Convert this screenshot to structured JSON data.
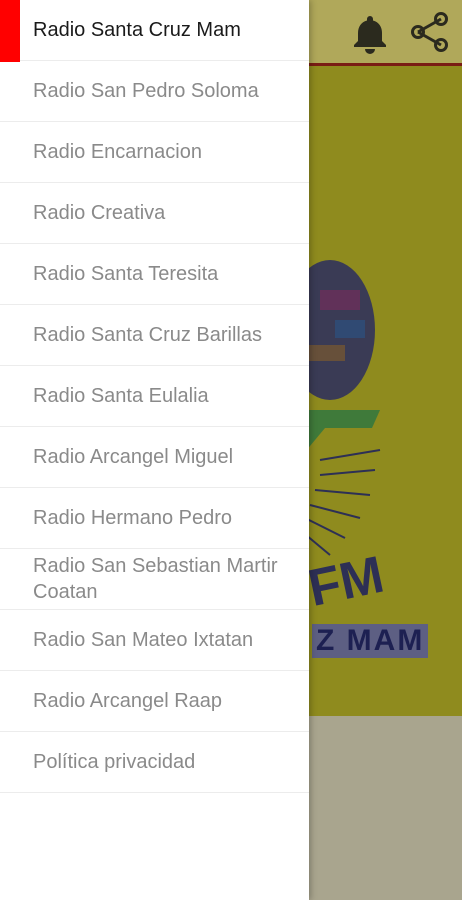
{
  "colors": {
    "accent": "#ff0000",
    "drawer_bg": "#ffffff",
    "active_text": "#1a1a1a",
    "inactive_text": "#8a8a8a",
    "toolbar_bg": "#b0a85a",
    "hero_bg": "#8f8b1e"
  },
  "toolbar": {
    "icons": [
      "bell-icon",
      "share-icon"
    ]
  },
  "logo": {
    "text": "Z MAM"
  },
  "drawer": {
    "active_index": 0,
    "items": [
      {
        "label": "Radio Santa Cruz Mam"
      },
      {
        "label": "Radio San Pedro Soloma"
      },
      {
        "label": "Radio Encarnacion"
      },
      {
        "label": "Radio Creativa"
      },
      {
        "label": "Radio Santa Teresita"
      },
      {
        "label": "Radio Santa Cruz Barillas"
      },
      {
        "label": "Radio Santa Eulalia"
      },
      {
        "label": "Radio Arcangel Miguel"
      },
      {
        "label": "Radio Hermano Pedro"
      },
      {
        "label": "Radio San Sebastian Martir Coatan"
      },
      {
        "label": "Radio San Mateo Ixtatan"
      },
      {
        "label": "Radio Arcangel Raap"
      },
      {
        "label": "Política privacidad"
      }
    ]
  }
}
